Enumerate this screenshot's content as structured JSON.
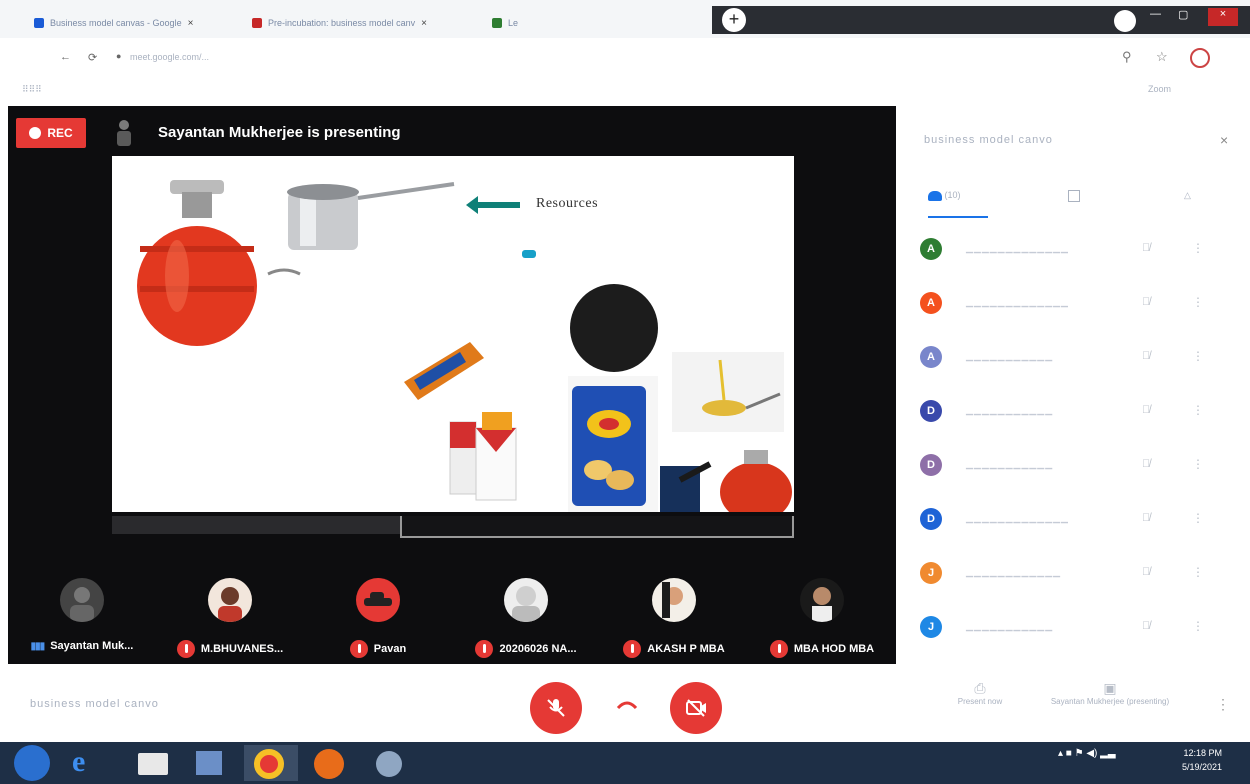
{
  "browser": {
    "tabs": [
      {
        "label": "Business model canvas - Google"
      },
      {
        "label": "Pre-incubation: business model canv"
      },
      {
        "label": "Le"
      }
    ],
    "url": "meet.google.com/...",
    "meeting_link": "Zoom"
  },
  "stage": {
    "rec_label": "REC",
    "presenting_text": "Sayantan Mukherjee is presenting",
    "slide": {
      "resources_label": "Resources"
    }
  },
  "participants": [
    {
      "name": "Sayantan Muk..."
    },
    {
      "name": "M.BHUVANES..."
    },
    {
      "name": "Pavan"
    },
    {
      "name": "20206026 NA..."
    },
    {
      "name": "AKASH P MBA"
    },
    {
      "name": "MBA HOD MBA"
    }
  ],
  "bottom": {
    "meeting_name": "business model canvo",
    "present_label": "Present now",
    "presenter_label": "Sayantan Mukherjee (presenting)"
  },
  "panel": {
    "title": "business model canvo",
    "close": "×",
    "tab_people_count": "(10)",
    "people": [
      {
        "initial": "A",
        "color": "#2e7d32"
      },
      {
        "initial": "A",
        "color": "#f4511e"
      },
      {
        "initial": "A",
        "color": "#7986cb"
      },
      {
        "initial": "D",
        "color": "#3949ab"
      },
      {
        "initial": "D",
        "color": "#8e6fa8"
      },
      {
        "initial": "D",
        "color": "#1e63d6"
      },
      {
        "initial": "J",
        "color": "#f08a30"
      },
      {
        "initial": "J",
        "color": "#1e88e5"
      }
    ]
  },
  "taskbar": {
    "time": "12:18 PM",
    "date": "5/19/2021"
  },
  "colors": {
    "red": "#e53935",
    "accent": "#1a73e8",
    "teal": "#0f8078"
  }
}
